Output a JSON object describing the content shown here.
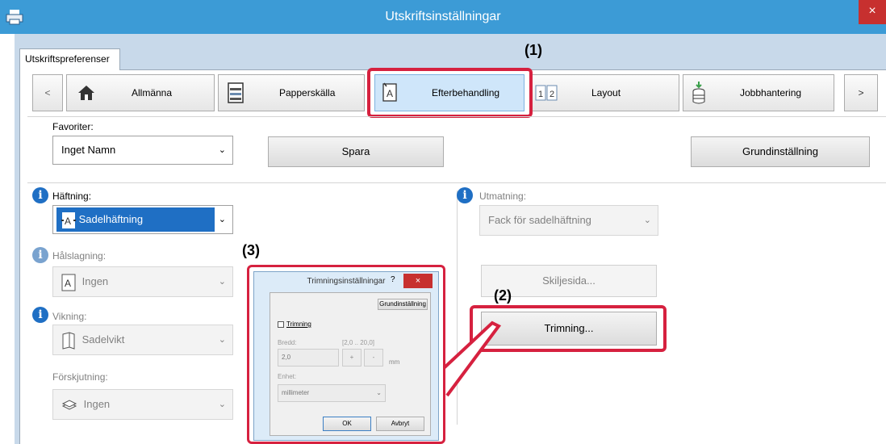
{
  "window": {
    "title": "Utskriftsinställningar",
    "close": "×"
  },
  "tab": {
    "label": "Utskriftspreferenser"
  },
  "nav": {
    "prev": "<",
    "next": ">",
    "items": [
      "Allmänna",
      "Papperskälla",
      "Efterbehandling",
      "Layout",
      "Jobbhantering"
    ]
  },
  "favorites": {
    "label": "Favoriter:",
    "value": "Inget Namn",
    "save": "Spara",
    "default": "Grundinställning"
  },
  "stapling": {
    "label": "Häftning:",
    "value": "Sadelhäftning"
  },
  "punch": {
    "label": "Hålslagning:",
    "value": "Ingen"
  },
  "fold": {
    "label": "Vikning:",
    "value": "Sadelvikt"
  },
  "shift": {
    "label": "Förskjutning:",
    "value": "Ingen"
  },
  "output": {
    "label": "Utmatning:",
    "value": "Fack för sadelhäftning"
  },
  "separator_btn": "Skiljesida...",
  "trimming_btn": "Trimning...",
  "callouts": {
    "c1": "(1)",
    "c2": "(2)",
    "c3": "(3)"
  },
  "dialog": {
    "title": "Trimningsinställningar",
    "help": "?",
    "close": "×",
    "default_btn": "Grundinställning",
    "checkbox_label": "Trimning",
    "width_label": "Bredd:",
    "width_range": "[2,0 .. 20,0]",
    "width_value": "2,0",
    "plus": "+",
    "minus": "-",
    "unit_suffix": "mm",
    "unit_label": "Enhet:",
    "unit_value": "millimeter",
    "ok": "OK",
    "cancel": "Avbryt"
  },
  "colors": {
    "titlebar": "#3c9bd6",
    "highlight": "#d6213f",
    "selected": "#1f6fc4"
  }
}
